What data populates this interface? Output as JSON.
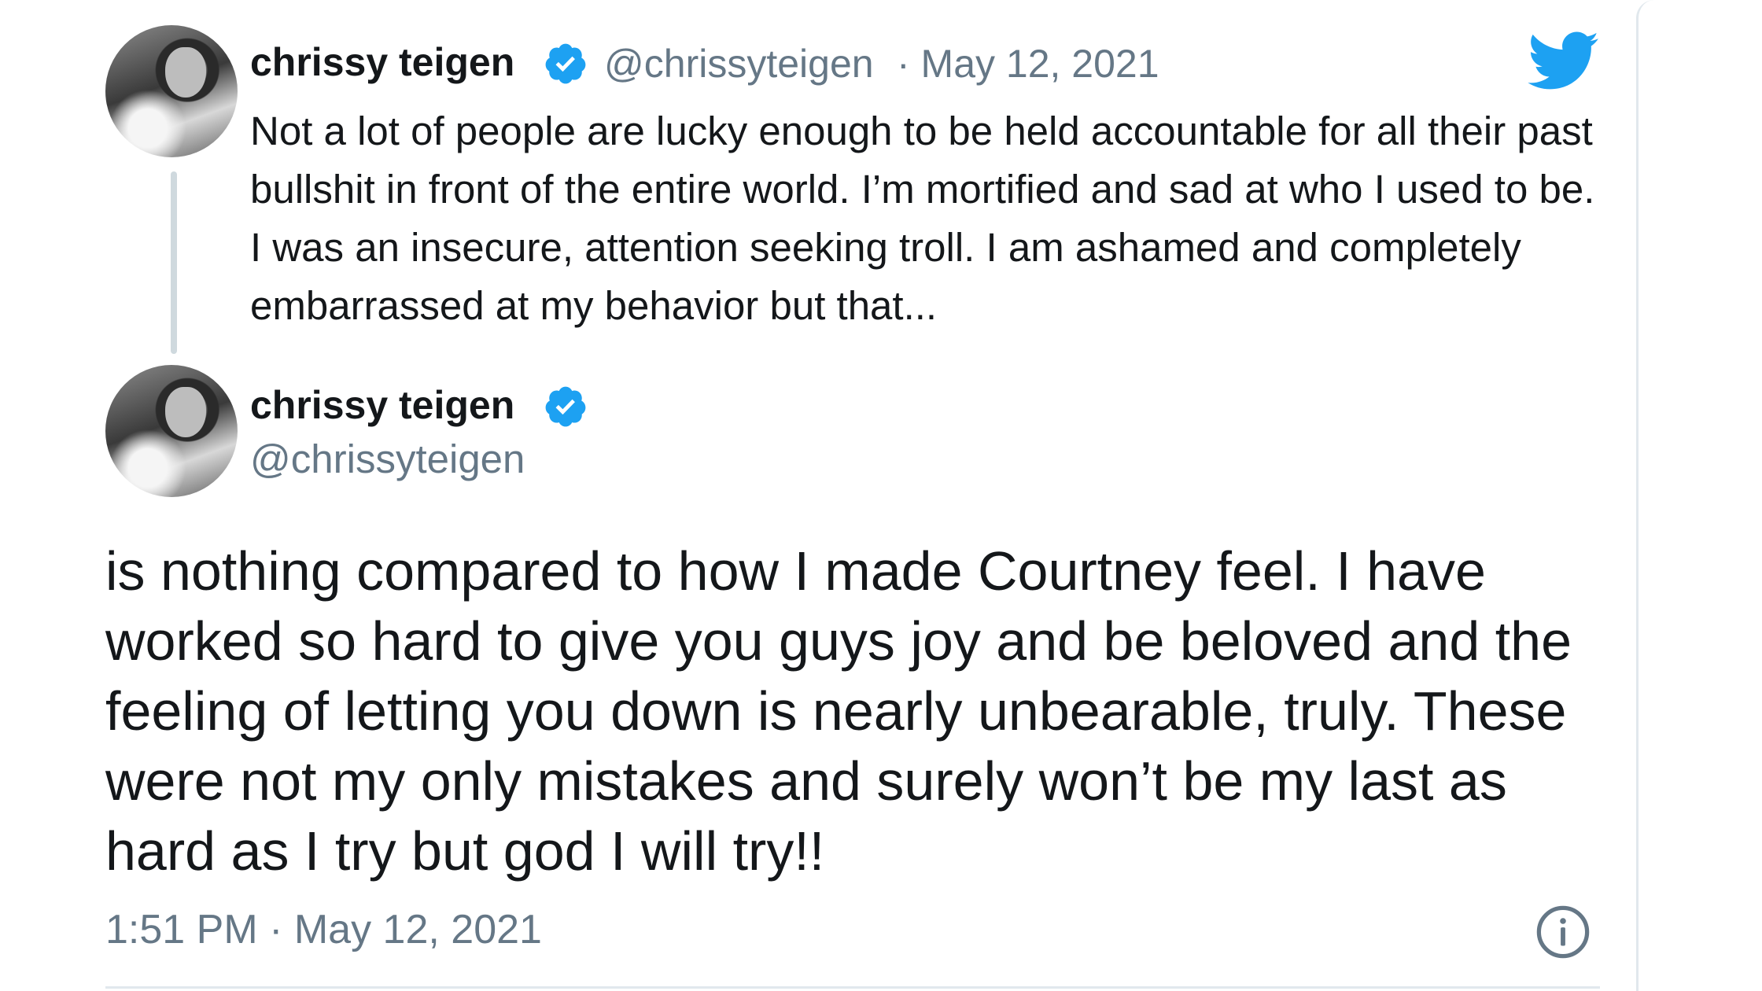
{
  "quoted_tweet": {
    "display_name": "chrissy teigen",
    "handle": "@chrissyteigen",
    "date": "· May 12, 2021",
    "text": "Not a lot of people are lucky enough to be held accountable for all their past bullshit in front of the entire world. I’m mortified and sad at who I used to be. I was an insecure, attention seeking troll. I am ashamed and completely embarrassed at my behavior but that..."
  },
  "main_tweet": {
    "display_name": "chrissy teigen",
    "handle": "@chrissyteigen",
    "text": "is nothing compared to how I made Courtney feel. I have worked so hard to give you guys joy and be beloved and the feeling of letting you down is nearly unbearable, truly. These were not my only mistakes and surely won’t be my last as hard as I try but god I will try!!",
    "timestamp": "1:51 PM · May 12, 2021"
  },
  "icons": {
    "brand": "twitter-bird-icon",
    "verified": "verified-badge-icon",
    "info": "info-icon"
  },
  "colors": {
    "twitter_blue": "#1da1f2",
    "secondary_text": "#657786",
    "primary_text": "#14171a",
    "border": "#e1e8ed"
  }
}
